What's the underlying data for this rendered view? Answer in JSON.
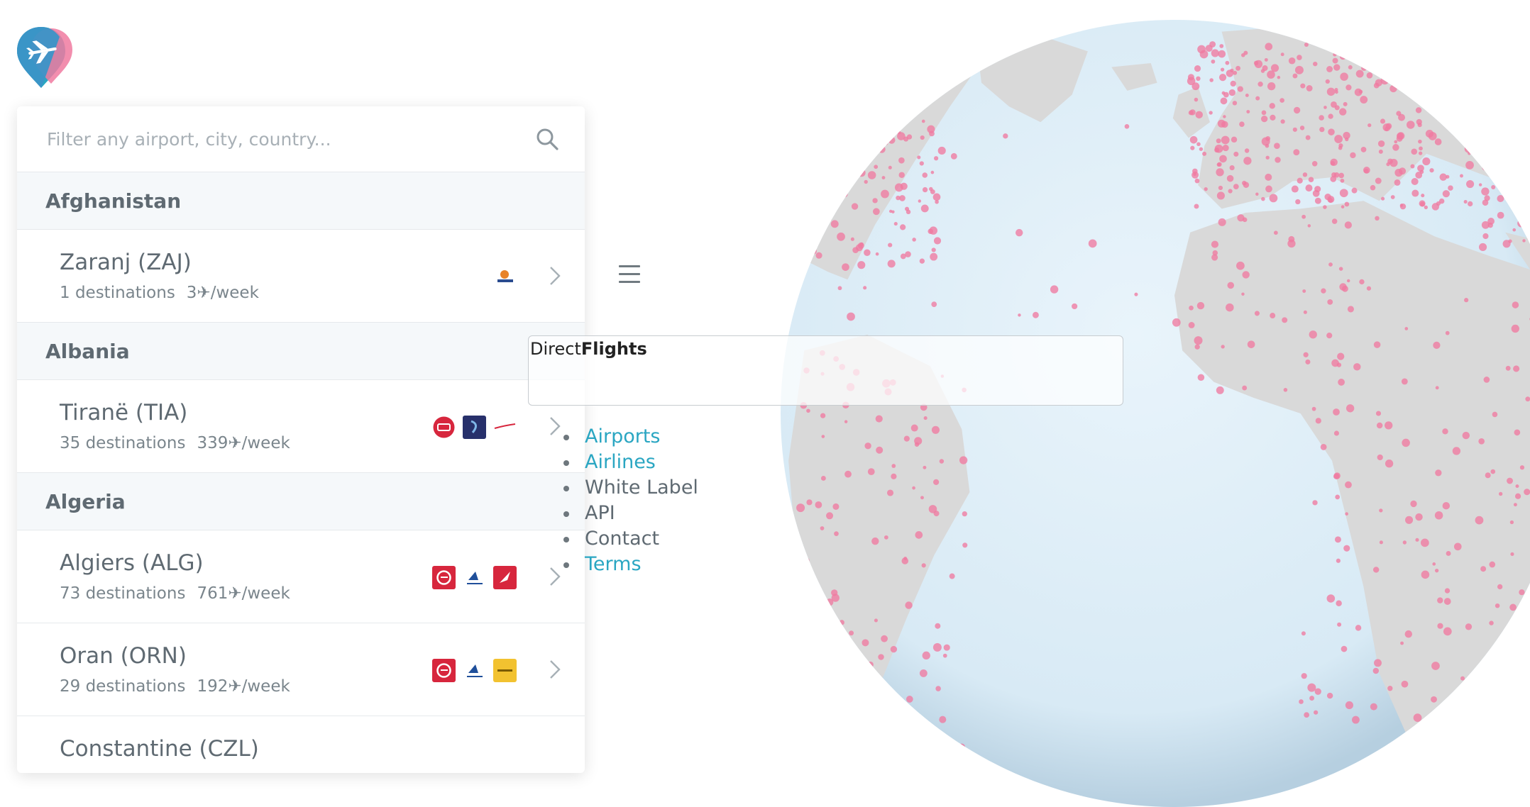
{
  "search": {
    "placeholder": "Filter any airport, city, country..."
  },
  "countries": [
    {
      "name": "Afghanistan"
    },
    {
      "name": "Albania"
    },
    {
      "name": "Algeria"
    }
  ],
  "airports": [
    {
      "name": "Zaranj (ZAJ)",
      "destinations": "1 destinations",
      "frequency": "3✈/week",
      "airline_logos": [
        "kam-air-logo"
      ]
    },
    {
      "name": "Tiranë (TIA)",
      "destinations": "35 destinations",
      "frequency": "339✈/week",
      "airline_logos": [
        "red-circle-logo",
        "blue-square-logo",
        "red-swoosh-logo"
      ]
    },
    {
      "name": "Algiers (ALG)",
      "destinations": "73 destinations",
      "frequency": "761✈/week",
      "airline_logos": [
        "air-algerie-logo",
        "blue-bird-logo",
        "turkish-airlines-logo"
      ]
    },
    {
      "name": "Oran (ORN)",
      "destinations": "29 destinations",
      "frequency": "192✈/week",
      "airline_logos": [
        "air-algerie-logo",
        "blue-bird-logo",
        "yellow-logo"
      ]
    },
    {
      "name": "Constantine (CZL)",
      "destinations": "",
      "frequency": "",
      "airline_logos": [
        "air-algerie-logo",
        "red-logo",
        "dark-logo"
      ]
    }
  ],
  "brand": {
    "part1": "Direct",
    "part2": "Flights"
  },
  "menu": [
    {
      "label": "Airports",
      "link": true
    },
    {
      "label": "Airlines",
      "link": true
    },
    {
      "label": "White Label",
      "link": false
    },
    {
      "label": "API",
      "link": false
    },
    {
      "label": "Contact",
      "link": false
    },
    {
      "label": "Terms",
      "link": true
    }
  ],
  "colors": {
    "accent": "#2aa6c2",
    "pink_dots": "#f07aa0",
    "ocean": "#deeef8",
    "land": "#d9d9d9",
    "logo_blue": "#2aa6c2",
    "logo_pink": "#f07aa0"
  },
  "icons": {
    "search": "search-icon",
    "chevron": "chevron-right-icon",
    "menu": "hamburger-menu-icon",
    "logo": "airplane-pin-logo"
  }
}
